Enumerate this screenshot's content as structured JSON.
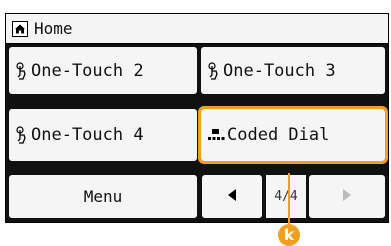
{
  "header": {
    "title": "Home",
    "icon": "home-icon"
  },
  "buttons": [
    {
      "label": "One-Touch 2",
      "icon": "one-touch-icon"
    },
    {
      "label": "One-Touch 3",
      "icon": "one-touch-icon"
    },
    {
      "label": "One-Touch 4",
      "icon": "one-touch-icon"
    },
    {
      "label": "Coded Dial",
      "icon": "coded-dial-icon"
    }
  ],
  "footer": {
    "menu_label": "Menu",
    "page_indicator": "4/4",
    "prev_icon": "triangle-left-icon",
    "next_icon": "triangle-right-icon"
  },
  "callout": {
    "label": "k",
    "color": "#f0a020"
  },
  "colors": {
    "panel_bg": "#111111",
    "button_bg": "#f5f5f5",
    "highlight": "#f0a020"
  }
}
